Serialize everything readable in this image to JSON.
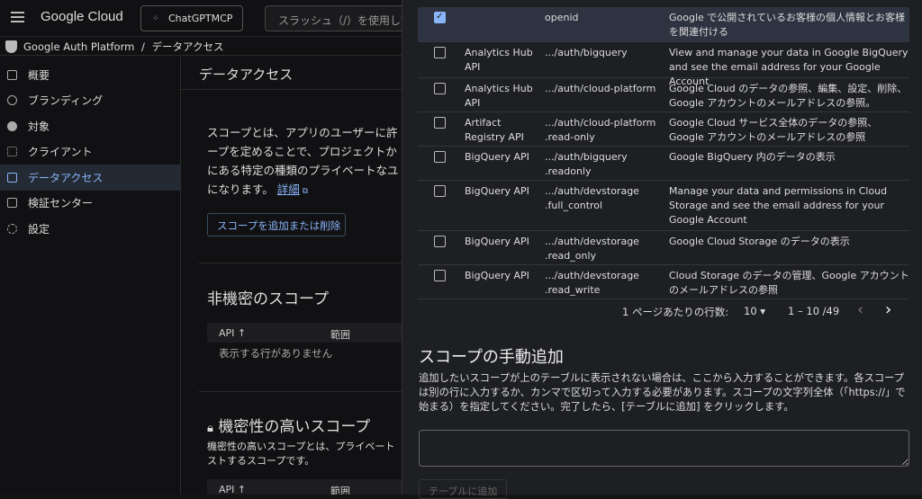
{
  "topbar": {
    "logo": "Google Cloud",
    "project": "ChatGPTMCP",
    "search_placeholder": "スラッシュ（/）を使用して"
  },
  "breadcrumb": {
    "product": "Google Auth Platform",
    "sep": "/",
    "current": "データアクセス"
  },
  "sidebar": {
    "items": [
      {
        "label": "概要",
        "icon": "dashboard-icon"
      },
      {
        "label": "ブランディング",
        "icon": "palette-icon"
      },
      {
        "label": "対象",
        "icon": "person-icon"
      },
      {
        "label": "クライアント",
        "icon": "grid-icon"
      },
      {
        "label": "データアクセス",
        "icon": "data-access-icon",
        "active": true
      },
      {
        "label": "検証センター",
        "icon": "verify-icon"
      },
      {
        "label": "設定",
        "icon": "gear-icon"
      }
    ]
  },
  "main": {
    "title": "データアクセス",
    "intro": [
      "スコープとは、アプリのユーザーに許",
      "ープを定めることで、プロジェクトか",
      "にある特定の種類のプライベートなユ",
      "になります。"
    ],
    "details_link": "詳細",
    "add_remove_button": "スコープを追加または削除",
    "nonsensitive": {
      "title": "非機密のスコープ",
      "col_api": "API ↑",
      "col_scope": "範囲",
      "empty": "表示する行がありません"
    },
    "sensitive": {
      "title": "機密性の高いスコープ",
      "desc": [
        "機密性の高いスコープとは、プライベート",
        "ストするスコープです。"
      ],
      "col_api": "API ↑",
      "col_scope": "範囲"
    }
  },
  "panel": {
    "rows": [
      {
        "checked": true,
        "api": "",
        "scope": "openid",
        "desc": "Google で公開されているお客様の個人情報とお客様を関連付ける"
      },
      {
        "checked": false,
        "api": "Analytics Hub API",
        "scope": ".../auth/bigquery",
        "desc": "View and manage your data in Google BigQuery and see the email address for your Google Account"
      },
      {
        "checked": false,
        "api": "Analytics Hub API",
        "scope": ".../auth/cloud-platform",
        "desc": "Google Cloud のデータの参照、編集、設定、削除、Google アカウントのメールアドレスの参照。"
      },
      {
        "checked": false,
        "api": "Artifact Registry API",
        "scope": ".../auth/cloud-platform .read-only",
        "desc": "Google Cloud サービス全体のデータの参照、Google アカウントのメールアドレスの参照"
      },
      {
        "checked": false,
        "api": "BigQuery API",
        "scope": ".../auth/bigquery .readonly",
        "desc": "Google BigQuery 内のデータの表示"
      },
      {
        "checked": false,
        "api": "BigQuery API",
        "scope": ".../auth/devstorage .full_control",
        "desc": "Manage your data and permissions in Cloud Storage and see the email address for your Google Account"
      },
      {
        "checked": false,
        "api": "BigQuery API",
        "scope": ".../auth/devstorage .read_only",
        "desc": "Google Cloud Storage のデータの表示"
      },
      {
        "checked": false,
        "api": "BigQuery API",
        "scope": ".../auth/devstorage .read_write",
        "desc": "Cloud Storage のデータの管理、Google アカウントのメールアドレスの参照"
      }
    ],
    "pagination": {
      "rows_label": "1 ページあたりの行数:",
      "rows_value": "10 ▾",
      "range": "1 – 10 /49",
      "prev": "‹",
      "next": "›"
    },
    "manual": {
      "title": "スコープの手動追加",
      "desc": "追加したいスコープが上のテーブルに表示されない場合は、ここから入力することができます。各スコープは別の行に入力するか、カンマで区切って入力する必要があります。スコープの文字列全体（「https://」で始まる）を指定してください。完了したら、[テーブルに追加] をクリックします。",
      "textarea_value": "",
      "add_button": "テーブルに追加"
    }
  }
}
